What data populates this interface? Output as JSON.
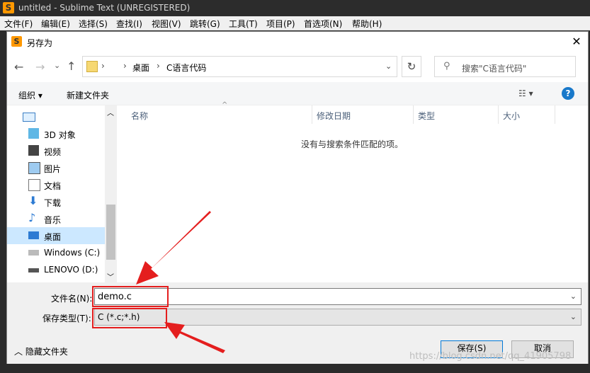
{
  "sublime": {
    "title": "untitled - Sublime Text (UNREGISTERED)",
    "menu": [
      "文件(F)",
      "编辑(E)",
      "选择(S)",
      "查找(I)",
      "视图(V)",
      "跳转(G)",
      "工具(T)",
      "项目(P)",
      "首选项(N)",
      "帮助(H)"
    ]
  },
  "dialog": {
    "title": "另存为",
    "close_label": "✕",
    "address": {
      "crumbs": [
        "桌面",
        "C语言代码"
      ]
    },
    "search_placeholder": "搜索\"C语言代码\"",
    "toolbar": {
      "organize": "组织 ▾",
      "new_folder": "新建文件夹"
    },
    "nav_items": [
      "3D 对象",
      "视频",
      "图片",
      "文档",
      "下载",
      "音乐",
      "桌面",
      "Windows (C:)",
      "LENOVO (D:)"
    ],
    "nav_selected": "桌面",
    "columns": [
      "名称",
      "修改日期",
      "类型",
      "大小"
    ],
    "empty_message": "没有与搜索条件匹配的项。",
    "filename_label": "文件名(N):",
    "filename_value": "demo.c",
    "filetype_label": "保存类型(T):",
    "filetype_value": "C (*.c;*.h)",
    "hide_folders": "隐藏文件夹",
    "save_button": "保存(S)",
    "cancel_button": "取消"
  },
  "watermark": "https://blog.csdn.net/qq_41905798",
  "colors": {
    "annotation": "#e41e1e",
    "selected": "#cce8ff",
    "sublime_logo": "#ff9800"
  }
}
